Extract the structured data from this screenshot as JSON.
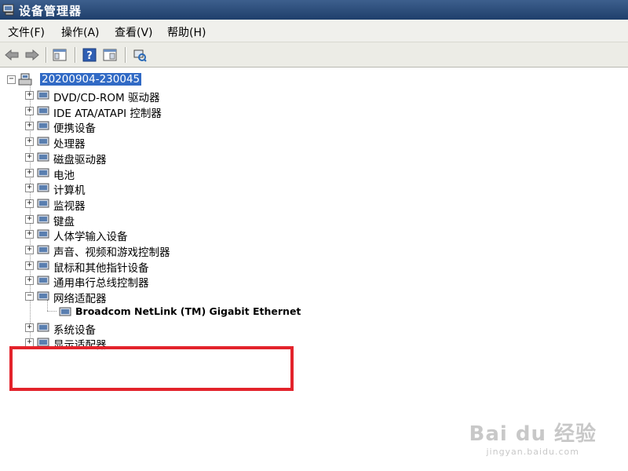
{
  "window": {
    "title": "设备管理器"
  },
  "menu": [
    "文件(F)",
    "操作(A)",
    "查看(V)",
    "帮助(H)"
  ],
  "toolbar": {
    "buttons": [
      "back-arrow-icon",
      "forward-arrow-icon",
      "show-hide-console-tree-icon",
      "help-icon",
      "properties-icon",
      "scan-hardware-icon"
    ]
  },
  "tree": {
    "root": "20200904-230045",
    "items": [
      {
        "label": "DVD/CD-ROM 驱动器",
        "expander": "+",
        "icon": "dvd-drive-icon"
      },
      {
        "label": "IDE ATA/ATAPI 控制器",
        "expander": "+",
        "icon": "ide-controller-icon"
      },
      {
        "label": "便携设备",
        "expander": "+",
        "icon": "portable-device-icon"
      },
      {
        "label": "处理器",
        "expander": "+",
        "icon": "processor-icon"
      },
      {
        "label": "磁盘驱动器",
        "expander": "+",
        "icon": "disk-drive-icon"
      },
      {
        "label": "电池",
        "expander": "+",
        "icon": "battery-icon"
      },
      {
        "label": "计算机",
        "expander": "+",
        "icon": "computer-icon"
      },
      {
        "label": "监视器",
        "expander": "+",
        "icon": "monitor-icon"
      },
      {
        "label": "键盘",
        "expander": "+",
        "icon": "keyboard-icon"
      },
      {
        "label": "人体学输入设备",
        "expander": "+",
        "icon": "hid-icon"
      },
      {
        "label": "声音、视频和游戏控制器",
        "expander": "+",
        "icon": "sound-icon"
      },
      {
        "label": "鼠标和其他指针设备",
        "expander": "+",
        "icon": "mouse-icon"
      },
      {
        "label": "通用串行总线控制器",
        "expander": "+",
        "icon": "usb-icon"
      },
      {
        "label": "网络适配器",
        "expander": "−",
        "icon": "network-adapter-icon"
      },
      {
        "label": "Broadcom NetLink (TM) Gigabit Ethernet",
        "expander": "",
        "icon": "network-card-icon"
      },
      {
        "label": "系统设备",
        "expander": "+",
        "icon": "system-device-icon"
      },
      {
        "label": "显示适配器",
        "expander": "+",
        "icon": "display-adapter-icon"
      }
    ]
  },
  "watermark": {
    "brand": "Bai du 经验",
    "url": "jingyan.baidu.com"
  },
  "colors": {
    "selection": "#316ac5",
    "highlight_box": "#e3232b",
    "titlebar": "#2a4a78"
  }
}
